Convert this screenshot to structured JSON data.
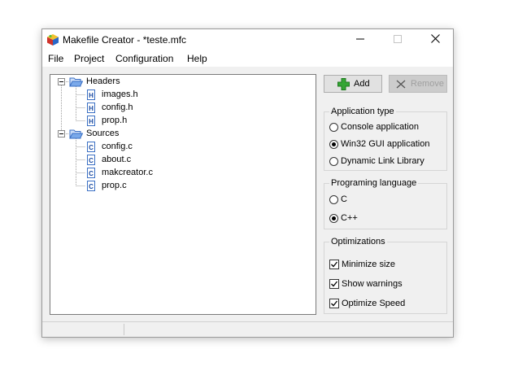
{
  "window": {
    "title": "Makefile Creator - *teste.mfc",
    "app_icon": "cube-app-icon",
    "controls": {
      "minimize_icon": "minimize-icon",
      "maximize_icon": "maximize-icon",
      "close_icon": "close-icon"
    }
  },
  "menu": [
    "File",
    "Project",
    "Configuration",
    "Help"
  ],
  "tree": {
    "groups": [
      {
        "label": "Headers",
        "expanded": true,
        "icon": "folder-open-icon",
        "items": [
          {
            "label": "images.h",
            "icon": "header-file-icon",
            "icon_letter": "H"
          },
          {
            "label": "config.h",
            "icon": "header-file-icon",
            "icon_letter": "H"
          },
          {
            "label": "prop.h",
            "icon": "header-file-icon",
            "icon_letter": "H"
          }
        ]
      },
      {
        "label": "Sources",
        "expanded": true,
        "icon": "folder-open-icon",
        "items": [
          {
            "label": "config.c",
            "icon": "source-file-icon",
            "icon_letter": "C"
          },
          {
            "label": "about.c",
            "icon": "source-file-icon",
            "icon_letter": "C"
          },
          {
            "label": "makcreator.c",
            "icon": "source-file-icon",
            "icon_letter": "C"
          },
          {
            "label": "prop.c",
            "icon": "source-file-icon",
            "icon_letter": "C"
          }
        ]
      }
    ],
    "expander_symbol": "⊟"
  },
  "buttons": {
    "add": {
      "label": "Add",
      "icon": "plus-icon",
      "enabled": true
    },
    "remove": {
      "label": "Remove",
      "icon": "x-icon",
      "enabled": false
    }
  },
  "application_type": {
    "title": "Application type",
    "options": [
      {
        "label": "Console application",
        "selected": false
      },
      {
        "label": "Win32 GUI application",
        "selected": true
      },
      {
        "label": "Dynamic Link Library",
        "selected": false
      }
    ]
  },
  "programming_language": {
    "title": "Programing language",
    "options": [
      {
        "label": "C",
        "selected": false
      },
      {
        "label": "C++",
        "selected": true
      }
    ]
  },
  "optimizations": {
    "title": "Optimizations",
    "options": [
      {
        "label": "Minimize size",
        "checked": true
      },
      {
        "label": "Show warnings",
        "checked": true
      },
      {
        "label": "Optimize Speed",
        "checked": true
      }
    ]
  },
  "colors": {
    "folder": "#4a86d8",
    "add_icon": "#2fa12f",
    "disabled_text": "#a0a0a0"
  }
}
